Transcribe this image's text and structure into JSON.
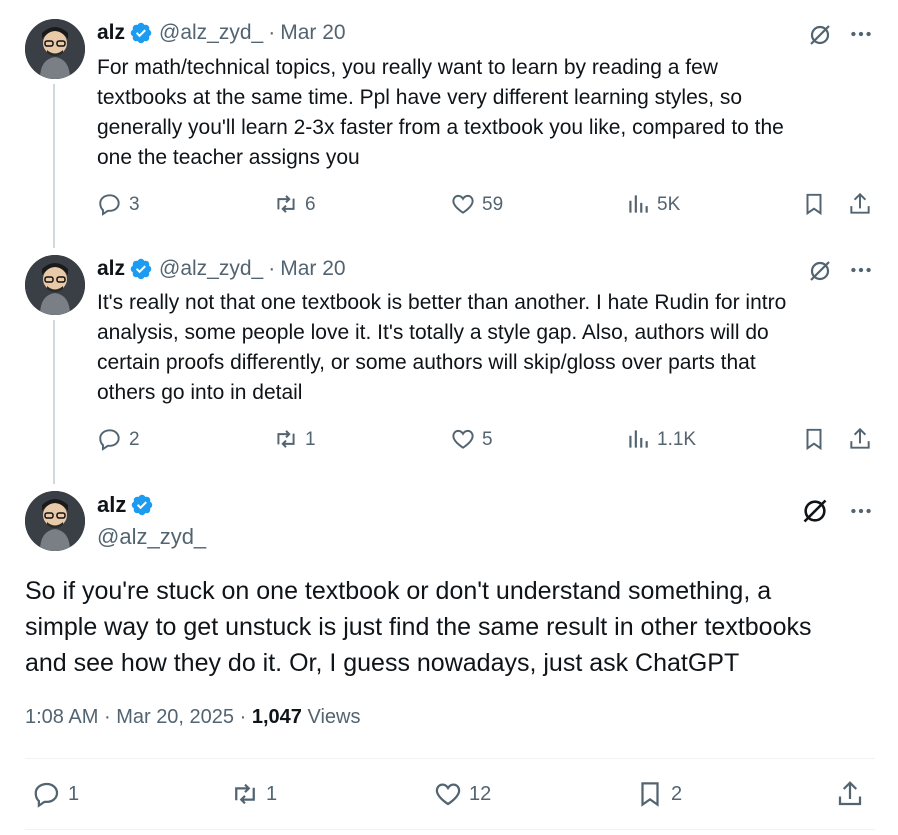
{
  "tweets": [
    {
      "name": "alz",
      "handle": "@alz_zyd_",
      "sep": "·",
      "date": "Mar 20",
      "lines": [
        "For math/technical topics, you really want to learn by reading a few",
        "textbooks at the same time. Ppl have very different learning styles, so",
        "generally you'll learn 2-3x faster from a textbook you like, compared to the",
        "one the teacher assigns you"
      ],
      "replies": "3",
      "reposts": "6",
      "likes": "59",
      "views": "5K"
    },
    {
      "name": "alz",
      "handle": "@alz_zyd_",
      "sep": "·",
      "date": "Mar 20",
      "lines": [
        "It's really not that one textbook is better than another. I hate Rudin for intro",
        "analysis, some people love it. It's totally a style gap. Also, authors will do",
        "certain proofs differently, or some authors will skip/gloss over parts that",
        "others go into in detail"
      ],
      "replies": "2",
      "reposts": "1",
      "likes": "5",
      "views": "1.1K"
    }
  ],
  "main": {
    "name": "alz",
    "handle": "@alz_zyd_",
    "lines": [
      "So if you're stuck on one textbook or don't understand something, a",
      "simple way to get unstuck is just find the same result in other textbooks",
      "and see how they do it. Or, I guess nowadays, just ask ChatGPT"
    ],
    "time": "1:08 AM",
    "sep": "·",
    "date": "Mar 20, 2025",
    "views_count": "1,047",
    "views_label": "Views",
    "replies": "1",
    "reposts": "1",
    "likes": "12",
    "bookmarks": "2"
  },
  "icons": [
    "verified-icon",
    "grok-icon",
    "more-icon",
    "reply-icon",
    "repost-icon",
    "like-icon",
    "views-icon",
    "bookmark-icon",
    "share-icon"
  ],
  "colors": {
    "text": "#0f1419",
    "muted": "#536471",
    "verified": "#1d9bf0",
    "line": "#cfd9de"
  }
}
